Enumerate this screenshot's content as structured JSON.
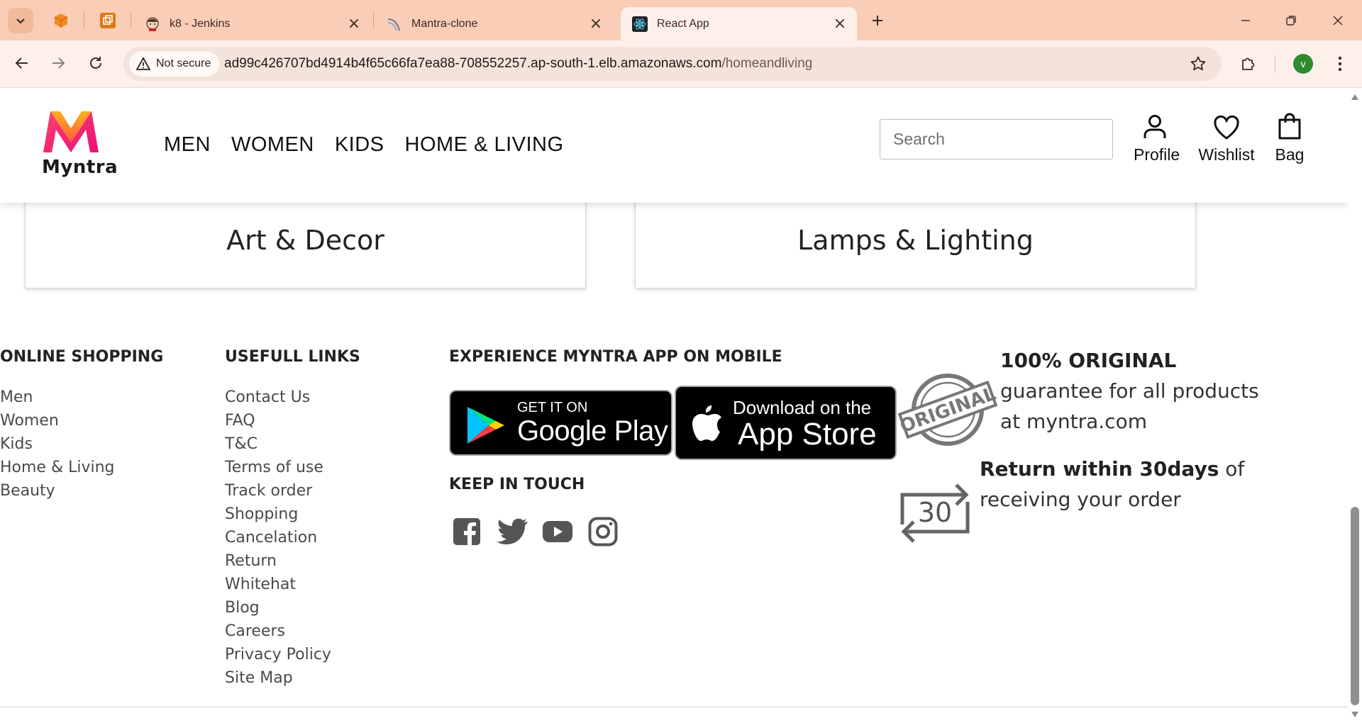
{
  "browser": {
    "tabs": [
      {
        "title": "k8 - Jenkins"
      },
      {
        "title": "Mantra-clone"
      },
      {
        "title": "React App"
      }
    ],
    "security_label": "Not secure",
    "url_host": "ad99c426707bd4914b4f65c66fa7ea88-708552257.ap-south-1.elb.amazonaws.com",
    "url_path": "/homeandliving",
    "profile_initial": "v"
  },
  "header": {
    "logo_text": "Myntra",
    "nav": [
      "MEN",
      "WOMEN",
      "KIDS",
      "HOME & LIVING"
    ],
    "search_placeholder": "Search",
    "actions": {
      "profile": "Profile",
      "wishlist": "Wishlist",
      "bag": "Bag"
    }
  },
  "categories": [
    "Art & Decor",
    "Lamps & Lighting"
  ],
  "footer": {
    "online_shopping": {
      "heading": "ONLINE SHOPPING",
      "links": [
        "Men",
        "Women",
        "Kids",
        "Home & Living",
        "Beauty"
      ]
    },
    "useful_links": {
      "heading": "USEFULL LINKS",
      "links": [
        "Contact Us",
        "FAQ",
        "T&C",
        "Terms of use",
        "Track order",
        "Shopping",
        "Cancelation",
        "Return",
        "Whitehat",
        "Blog",
        "Careers",
        "Privacy Policy",
        "Site Map"
      ]
    },
    "app": {
      "heading": "EXPERIENCE MYNTRA APP ON MOBILE",
      "google_small": "GET IT ON",
      "google_big": "Google Play",
      "apple_small": "Download on the",
      "apple_big": "App Store"
    },
    "keep_in_touch": {
      "heading": "KEEP IN TOUCH"
    },
    "original": {
      "bold": "100% ORIGINAL",
      "rest": " guarantee for all products at myntra.com",
      "badge": "ORIGINAL"
    },
    "returns": {
      "bold": "Return within 30days",
      "rest": " of receiving your order",
      "badge": "30"
    }
  }
}
